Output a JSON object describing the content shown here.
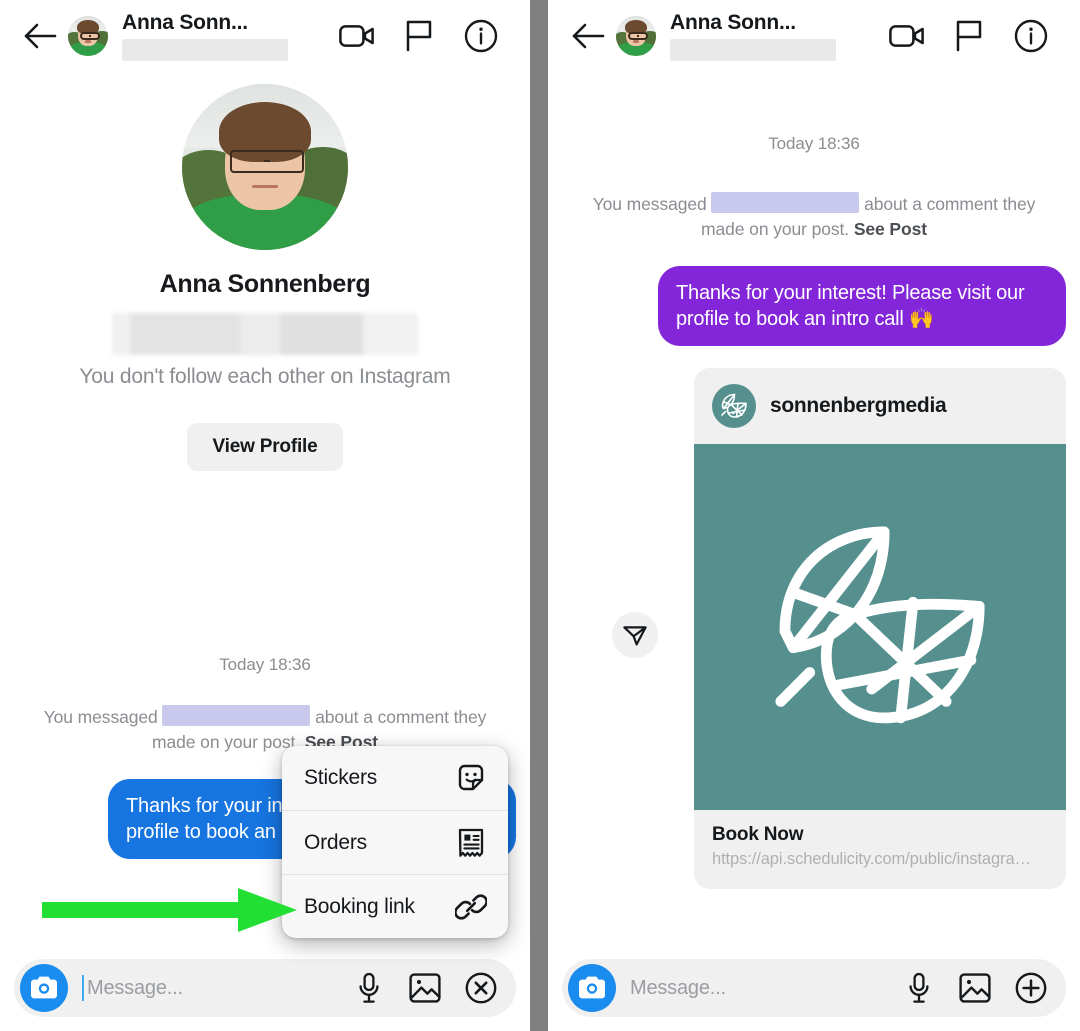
{
  "header": {
    "title": "Anna Sonn...",
    "back_icon": "back-arrow-icon",
    "video_icon": "video-call-icon",
    "flag_icon": "flag-icon",
    "info_icon": "info-icon",
    "avatar_alt": "Anna Sonnenberg"
  },
  "profile": {
    "name": "Anna Sonnenberg",
    "follow_status": "You don't follow each other on Instagram",
    "view_profile_label": "View Profile"
  },
  "thread": {
    "timestamp": "Today 18:36",
    "system_note_prefix": "You messaged",
    "system_note_suffix": "about a comment they made on your post.",
    "see_post_label": "See Post",
    "outgoing_message": "Thanks for your interest! Please visit our profile to book an intro call 🙌"
  },
  "post_card": {
    "username": "sonnenbergmedia",
    "cta_label": "Book Now",
    "url": "https://api.schedulicity.com/public/instagra…",
    "image_alt": "two-leaves-logo",
    "send_icon": "send-paper-plane-icon"
  },
  "composer": {
    "placeholder": "Message...",
    "camera_icon": "camera-icon",
    "mic_icon": "microphone-icon",
    "gallery_icon": "image-gallery-icon",
    "close_icon": "close-x-icon",
    "plus_icon": "plus-icon"
  },
  "popup_menu": {
    "items": [
      {
        "label": "Stickers",
        "icon": "sticker-icon"
      },
      {
        "label": "Orders",
        "icon": "receipt-icon"
      },
      {
        "label": "Booking link",
        "icon": "link-chain-icon"
      }
    ]
  },
  "annotation": {
    "arrow_color": "#22e033",
    "target": "Booking link"
  },
  "colors": {
    "bubble_blue": "#1675e0",
    "bubble_purple": "#8325d9",
    "brand_teal": "#55908f",
    "camera_blue": "#1a8cf0",
    "divider_gray": "#808080",
    "muted_text": "#8a8d91",
    "redact_lavender": "#c9c9ee"
  }
}
